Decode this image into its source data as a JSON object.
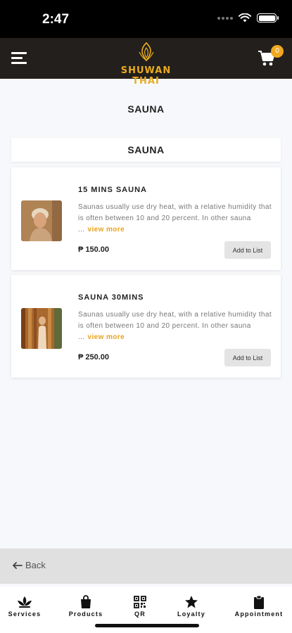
{
  "status_bar": {
    "time": "2:47"
  },
  "header": {
    "brand": "SHUWAN THAI",
    "cart_count": "0"
  },
  "page": {
    "title": "SAUNA",
    "category": "SAUNA"
  },
  "services": [
    {
      "name": "15 MINS SAUNA",
      "description": "Saunas usually use dry heat, with a relative humidity that is often between 10 and 20 percent. In other sauna ...",
      "view_more": "view more",
      "price": "₱ 150.00",
      "action": "Add to List"
    },
    {
      "name": "SAUNA 30MINS",
      "description": "Saunas usually use dry heat, with a relative humidity that is often between 10 and 20 percent. In other sauna ...",
      "view_more": "view more",
      "price": "₱ 250.00",
      "action": "Add to List"
    }
  ],
  "back": {
    "label": "Back"
  },
  "tabs": [
    {
      "label": "Services",
      "icon": "lotus-icon"
    },
    {
      "label": "Products",
      "icon": "shopping-bag-icon"
    },
    {
      "label": "QR",
      "icon": "qr-code-icon"
    },
    {
      "label": "Loyalty",
      "icon": "star-icon"
    },
    {
      "label": "Appointment",
      "icon": "clipboard-icon"
    }
  ],
  "colors": {
    "accent": "#e9ac1f",
    "header_bg": "#231f1c",
    "page_bg": "#f7f8fb"
  }
}
